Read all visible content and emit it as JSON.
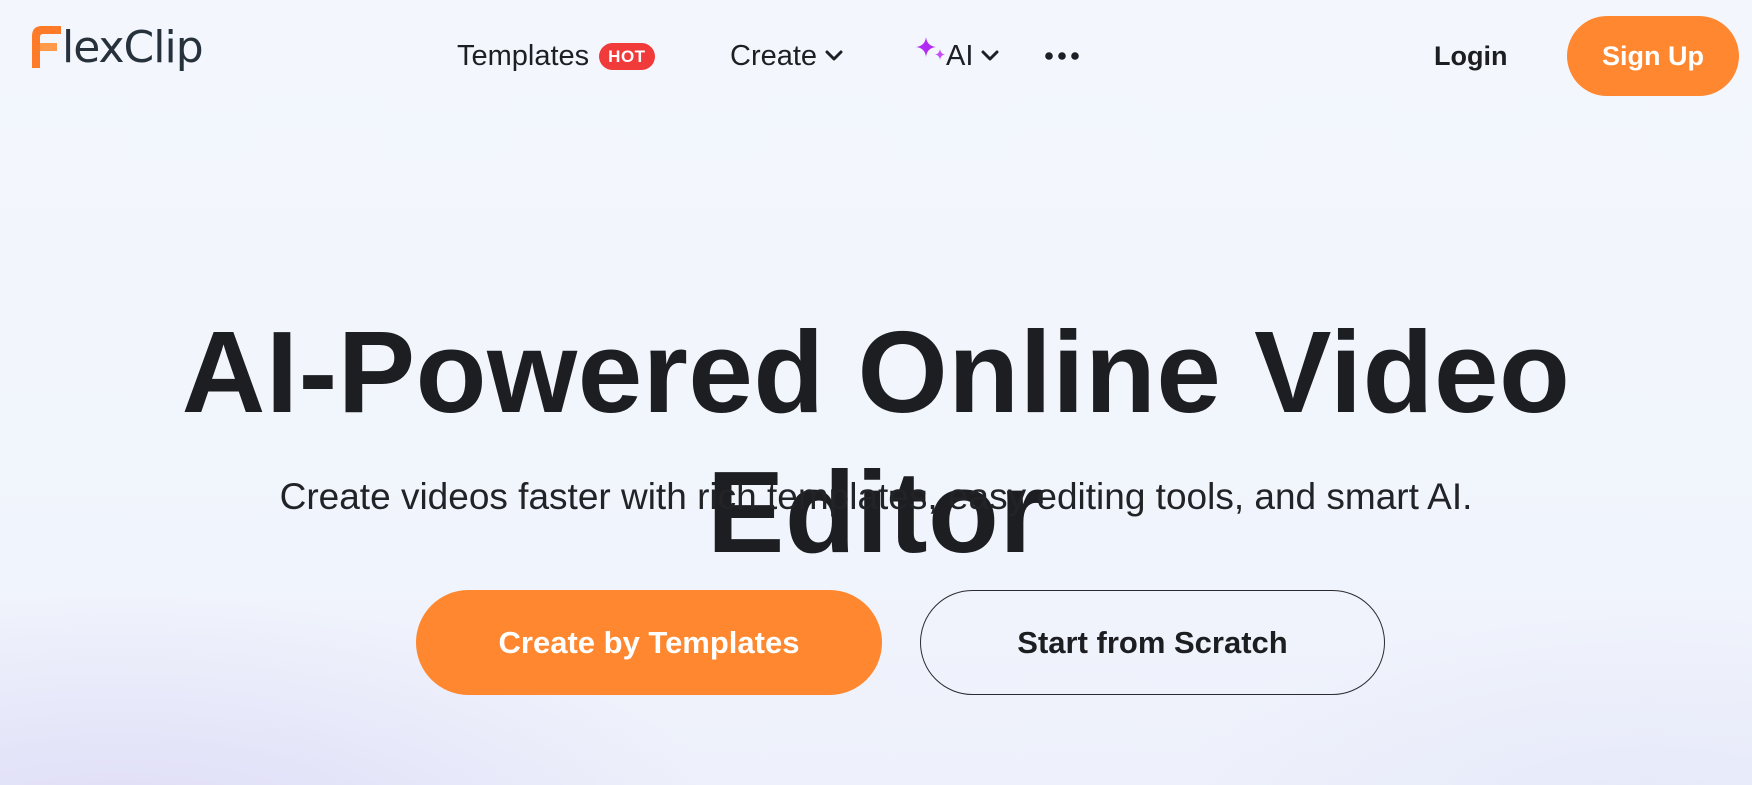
{
  "header": {
    "logo_text": "lexClip",
    "logo_brand": "FlexClip",
    "nav": {
      "templates_label": "Templates",
      "templates_badge": "HOT",
      "create_label": "Create",
      "ai_label": "AI",
      "more_icon": "ellipsis-icon"
    },
    "login_label": "Login",
    "signup_label": "Sign Up"
  },
  "hero": {
    "title": "AI-Powered Online Video Editor",
    "subtitle": "Create videos faster with rich templates, easy editing tools, and smart AI.",
    "primary_button": "Create by Templates",
    "secondary_button": "Start from Scratch"
  },
  "colors": {
    "accent_orange": "#fe872f",
    "hot_badge_red": "#f13b3b",
    "ai_sparkle_purple": "#b02cf2",
    "text_dark": "#1d1e22",
    "logo_text": "#27313b"
  },
  "icons": [
    "flexclip-logo-icon",
    "chevron-down-icon",
    "ai-sparkle-icon",
    "ellipsis-icon"
  ]
}
